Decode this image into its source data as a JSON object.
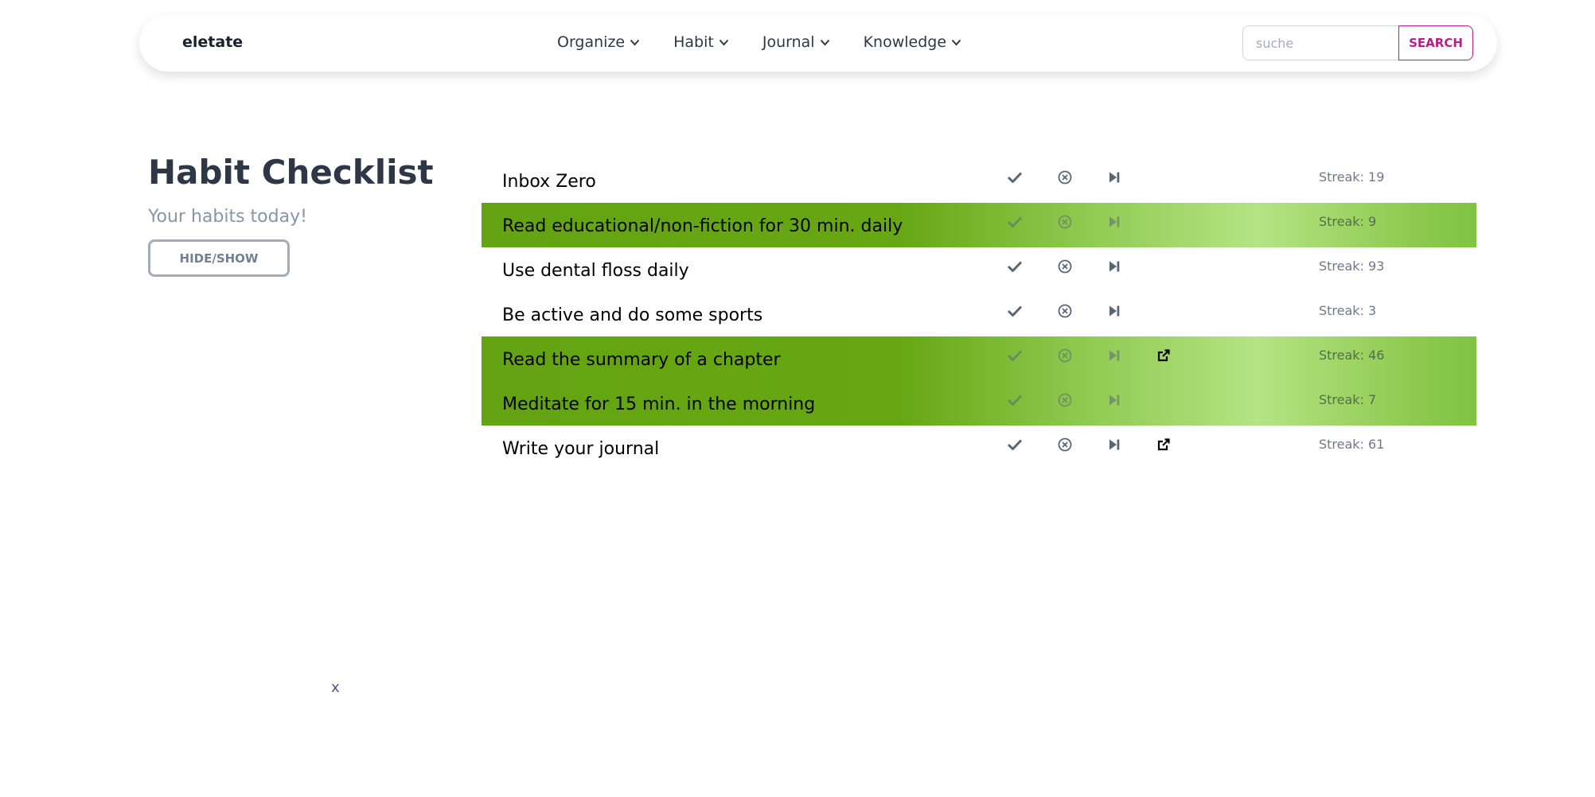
{
  "brand": "eletate",
  "nav": {
    "items": [
      {
        "label": "Organize",
        "icon": "chevron-down-icon"
      },
      {
        "label": "Habit",
        "icon": "chevron-down-icon"
      },
      {
        "label": "Journal",
        "icon": "chevron-down-icon"
      },
      {
        "label": "Knowledge",
        "icon": "chevron-down-icon"
      }
    ]
  },
  "search": {
    "placeholder": "suche",
    "value": "",
    "button_label": "SEARCH"
  },
  "page": {
    "title": "Habit Checklist",
    "subtitle": "Your habits today!",
    "hide_show_label": "HIDE/SHOW",
    "close_label": "x"
  },
  "colors": {
    "accent": "#b31f84",
    "done_green": "#66a713",
    "done_light": "#b4e484",
    "title": "#2d3748",
    "muted": "#8795a8"
  },
  "habits": [
    {
      "name": "Inbox Zero",
      "streak": "Streak: 19",
      "done": false,
      "has_link": false
    },
    {
      "name": "Read educational/non-fiction for 30 min. daily",
      "streak": "Streak: 9",
      "done": true,
      "has_link": false
    },
    {
      "name": "Use dental floss daily",
      "streak": "Streak: 93",
      "done": false,
      "has_link": false
    },
    {
      "name": "Be active and do some sports",
      "streak": "Streak: 3",
      "done": false,
      "has_link": false
    },
    {
      "name": "Read the summary of a chapter",
      "streak": "Streak: 46",
      "done": true,
      "has_link": true
    },
    {
      "name": "Meditate for 15 min. in the morning",
      "streak": "Streak: 7",
      "done": true,
      "has_link": false
    },
    {
      "name": "Write your journal",
      "streak": "Streak: 61",
      "done": false,
      "has_link": true
    }
  ]
}
